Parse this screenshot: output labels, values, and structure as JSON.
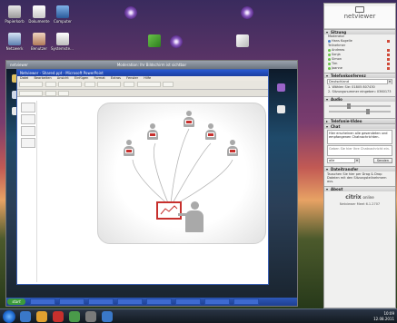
{
  "desktop_icons": [
    {
      "label": "Papierkorb",
      "icon": "recycle-bin-icon"
    },
    {
      "label": "Dokumente",
      "icon": "documents-icon"
    },
    {
      "label": "Computer",
      "icon": "computer-icon"
    },
    {
      "label": "Netzwerk",
      "icon": "network-icon"
    },
    {
      "label": "Benutzer",
      "icon": "user-icon"
    },
    {
      "label": "Systemsteuerung",
      "icon": "control-panel-icon"
    }
  ],
  "remote_window": {
    "title": "netviewer",
    "center_title": "Moderation: Ihr Bildschirm ist sichtbar"
  },
  "app_window": {
    "title": "Netviewer - Shared.ppt - Microsoft PowerPoint",
    "menu": [
      "Datei",
      "Bearbeiten",
      "Ansicht",
      "Einfügen",
      "Format",
      "Extras",
      "Fenster",
      "Hilfe"
    ]
  },
  "remote_taskbar": {
    "start_label": "start"
  },
  "panel": {
    "brand": "netviewer",
    "sections": {
      "sitzung": "Sitzung",
      "telefon": "Telefonkonferenz",
      "audio": "Audio",
      "telefon_video": "Telefonie-Video",
      "chat": "Chat",
      "dateitransfer": "Dateitransfer",
      "about": "About"
    },
    "moderator_label": "Moderator",
    "moderator_name": "Hans Kugelle",
    "participants_label": "Teilnehmer",
    "participants": [
      "Andreas",
      "Sonja",
      "Simon",
      "Tim",
      "Joanne"
    ],
    "country": "Deutschland",
    "dial_label": "1. Wählen Sie:",
    "dial_number": "01805 807430",
    "pin_label": "2. Sitzungsnummer eingeben:",
    "pin_value": "0360173",
    "chat_text": "Hier erscheinen alle gesendeten und empfangenen Chatnachrichten.",
    "chat_input_placeholder": "Geben Sie hier Ihre Chatnachricht ein.",
    "chat_recipient": "alle",
    "send_label": "Senden",
    "file_hint": "Tauschen Sie hier per Drag & Drop Dateien mit den Sitzungsteilnehmern aus.",
    "citrix_brand": "citrix",
    "citrix_suffix": "online",
    "version": "Netviewer Meet 6.1.2707"
  },
  "clock": {
    "time": "10:09",
    "date": "12.08.2011"
  },
  "colors": {
    "accent": "#c7302d",
    "panel_bg": "#f0f0ef"
  }
}
